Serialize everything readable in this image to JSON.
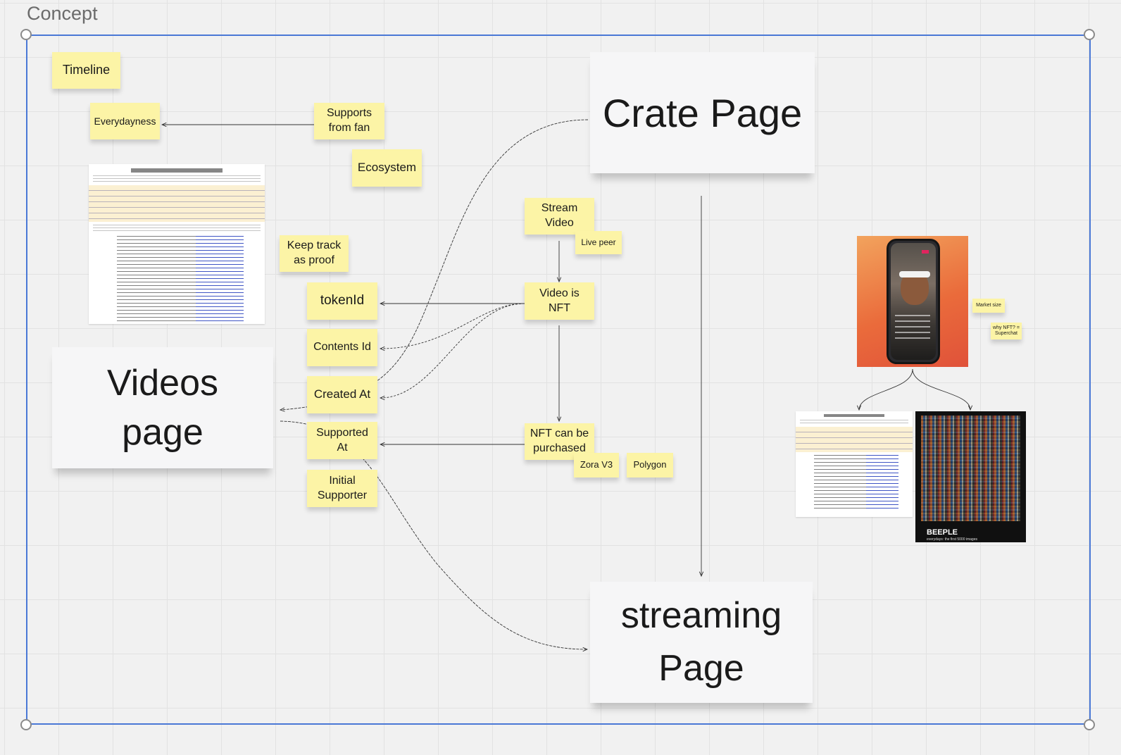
{
  "frame": {
    "title": "Concept",
    "border_color": "#4a78d6"
  },
  "colors": {
    "sticky": "#fcf4a6",
    "card": "#f6f6f7",
    "grid": "#e2e2e2",
    "canvas": "#f1f1f1"
  },
  "cards": {
    "crate_page": "Crate Page",
    "videos_page": "Videos\npage",
    "streaming_page": "streaming\nPage"
  },
  "stickies": {
    "timeline": "Timeline",
    "everydayness": "Everydayness",
    "supports_from_fan": "Supports\nfrom fan",
    "ecosystem": "Ecosystem",
    "keep_track": "Keep track\nas proof",
    "token_id": "tokenId",
    "contents_id": "Contents Id",
    "created_at": "Created At",
    "supported_at": "Supported\nAt",
    "initial_supporter": "Initial\nSupporter",
    "stream_video": "Stream\nVideo",
    "live_peer": "Live peer",
    "video_is_nft": "Video is\nNFT",
    "nft_purchased": "NFT can be\npurchased",
    "zora_v3": "Zora V3",
    "polygon": "Polygon",
    "market_size": "Market size",
    "why_nft": "why NFT? =\nSuperchat"
  },
  "images": {
    "beeple_title": "BEEPLE",
    "beeple_subtitle": "everydays: the first 5000 images"
  },
  "icons": [
    "phone-screenshot-image",
    "document-screenshot-image",
    "artwork-mosaic-image"
  ]
}
